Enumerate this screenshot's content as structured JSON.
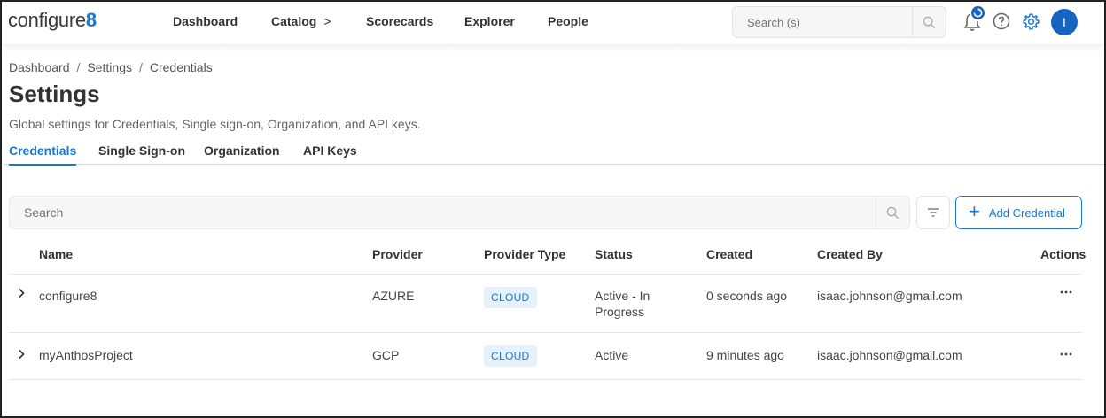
{
  "app": {
    "logo_text": "configure",
    "logo_suffix": "8"
  },
  "nav": {
    "items": [
      {
        "label": "Dashboard"
      },
      {
        "label": "Catalog",
        "chevron": ">"
      },
      {
        "label": "Scorecards"
      },
      {
        "label": "Explorer"
      },
      {
        "label": "People"
      }
    ],
    "search_placeholder": "Search (s)",
    "avatar_initial": "I",
    "icons": [
      "search-icon",
      "bell-icon",
      "help-icon",
      "gear-icon"
    ]
  },
  "breadcrumb": {
    "items": [
      "Dashboard",
      "Settings",
      "Credentials"
    ],
    "separator": "/"
  },
  "page": {
    "title": "Settings",
    "subtitle": "Global settings for Credentials, Single sign-on, Organization, and API keys."
  },
  "tabs": [
    {
      "label": "Credentials",
      "active": true
    },
    {
      "label": "Single Sign-on",
      "active": false
    },
    {
      "label": "Organization",
      "active": false
    },
    {
      "label": "API Keys",
      "active": false
    }
  ],
  "toolbar": {
    "search_placeholder": "Search",
    "add_label": "Add Credential"
  },
  "table": {
    "columns": [
      "Name",
      "Provider",
      "Provider Type",
      "Status",
      "Created",
      "Created By",
      "Actions"
    ],
    "rows": [
      {
        "name": "configure8",
        "provider": "AZURE",
        "provider_type": "CLOUD",
        "status": "Active - In Progress",
        "created": "0 seconds ago",
        "created_by": "isaac.johnson@gmail.com"
      },
      {
        "name": "myAnthosProject",
        "provider": "GCP",
        "provider_type": "CLOUD",
        "status": "Active",
        "created": "9 minutes ago",
        "created_by": "isaac.johnson@gmail.com"
      }
    ]
  },
  "colors": {
    "accent": "#1976d2",
    "badge_bg": "#e6f2fb",
    "text": "#333333"
  }
}
